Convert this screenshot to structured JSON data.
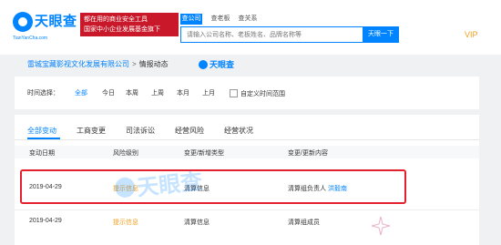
{
  "header": {
    "logo_text": "天眼查",
    "logo_sub": "TianYanCha.com",
    "slogan_line1": "都在用的商业安全工具",
    "slogan_line2": "国家中小企业发展基金旗下",
    "search_tabs": [
      "查公司",
      "查老板",
      "查关系"
    ],
    "search_placeholder": "请输入公司名称、老板姓名、品牌名称等",
    "search_button": "天眼一下",
    "vip_label": "VIP"
  },
  "breadcrumb": {
    "company": "雷城宝藏影视文化发展有限公司",
    "separator": ">",
    "current": "情报动态",
    "logo_text": "天眼查"
  },
  "filter": {
    "label": "时间选择：",
    "options": [
      "全部",
      "今日",
      "本周",
      "上周",
      "本月",
      "上月"
    ],
    "selected": "全部",
    "custom_label": "自定义时间范围"
  },
  "tabs": {
    "items": [
      "全部变动",
      "工商变更",
      "司法诉讼",
      "经营风险",
      "经营状况"
    ],
    "active": "全部变动"
  },
  "table": {
    "headers": [
      "变动日期",
      "风险级别",
      "变更/新增类型",
      "变更/更新内容"
    ],
    "rows": [
      {
        "date": "2019-04-29",
        "risk": "提示信息",
        "type": "清算信息",
        "content": "清算组负责人",
        "tag": "洪毅南"
      },
      {
        "date": "2019-04-29",
        "risk": "提示信息",
        "type": "清算信息",
        "content": "清算组成员",
        "tag": ""
      }
    ]
  },
  "watermark": {
    "text": "天眼查"
  },
  "colors": {
    "brand": "#0084ff",
    "slogan_bg": "#c9182a",
    "highlight": "#e5202e",
    "risk": "#f0a020"
  }
}
